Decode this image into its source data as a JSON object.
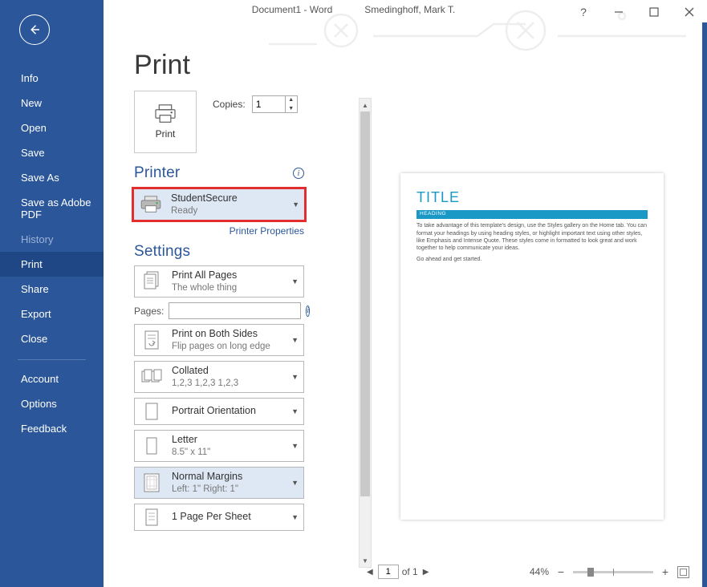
{
  "title_bar": {
    "doc": "Document1 - Word",
    "user": "Smedinghoff, Mark T."
  },
  "sidebar": {
    "items": [
      {
        "label": "Info"
      },
      {
        "label": "New"
      },
      {
        "label": "Open"
      },
      {
        "label": "Save"
      },
      {
        "label": "Save As"
      },
      {
        "label": "Save as Adobe PDF"
      },
      {
        "label": "History"
      },
      {
        "label": "Print"
      },
      {
        "label": "Share"
      },
      {
        "label": "Export"
      },
      {
        "label": "Close"
      }
    ],
    "lower": [
      {
        "label": "Account"
      },
      {
        "label": "Options"
      },
      {
        "label": "Feedback"
      }
    ]
  },
  "main": {
    "title": "Print",
    "print_button": "Print",
    "copies_label": "Copies:",
    "copies_value": "1",
    "printer": {
      "heading": "Printer",
      "name": "StudentSecure",
      "status": "Ready",
      "props_link": "Printer Properties"
    },
    "settings": {
      "heading": "Settings",
      "pages_label": "Pages:",
      "pages_value": "",
      "items": [
        {
          "l1": "Print All Pages",
          "l2": "The whole thing"
        },
        {
          "l1": "Print on Both Sides",
          "l2": "Flip pages on long edge"
        },
        {
          "l1": "Collated",
          "l2": "1,2,3    1,2,3    1,2,3"
        },
        {
          "l1": "Portrait Orientation",
          "l2": ""
        },
        {
          "l1": "Letter",
          "l2": "8.5\" x 11\""
        },
        {
          "l1": "Normal Margins",
          "l2": "Left:  1\"    Right:  1\""
        },
        {
          "l1": "1 Page Per Sheet",
          "l2": ""
        }
      ]
    }
  },
  "preview": {
    "title": "TITLE",
    "heading": "HEADING",
    "body1": "To take advantage of this template's design, use the Styles gallery on the Home tab. You can format your headings by using heading styles, or highlight important text using other styles, like Emphasis and Intense Quote. These styles come in formatted to look great and work together to help communicate your ideas.",
    "body2": "Go ahead and get started."
  },
  "status": {
    "page_current": "1",
    "page_of": "of 1",
    "zoom": "44%"
  }
}
